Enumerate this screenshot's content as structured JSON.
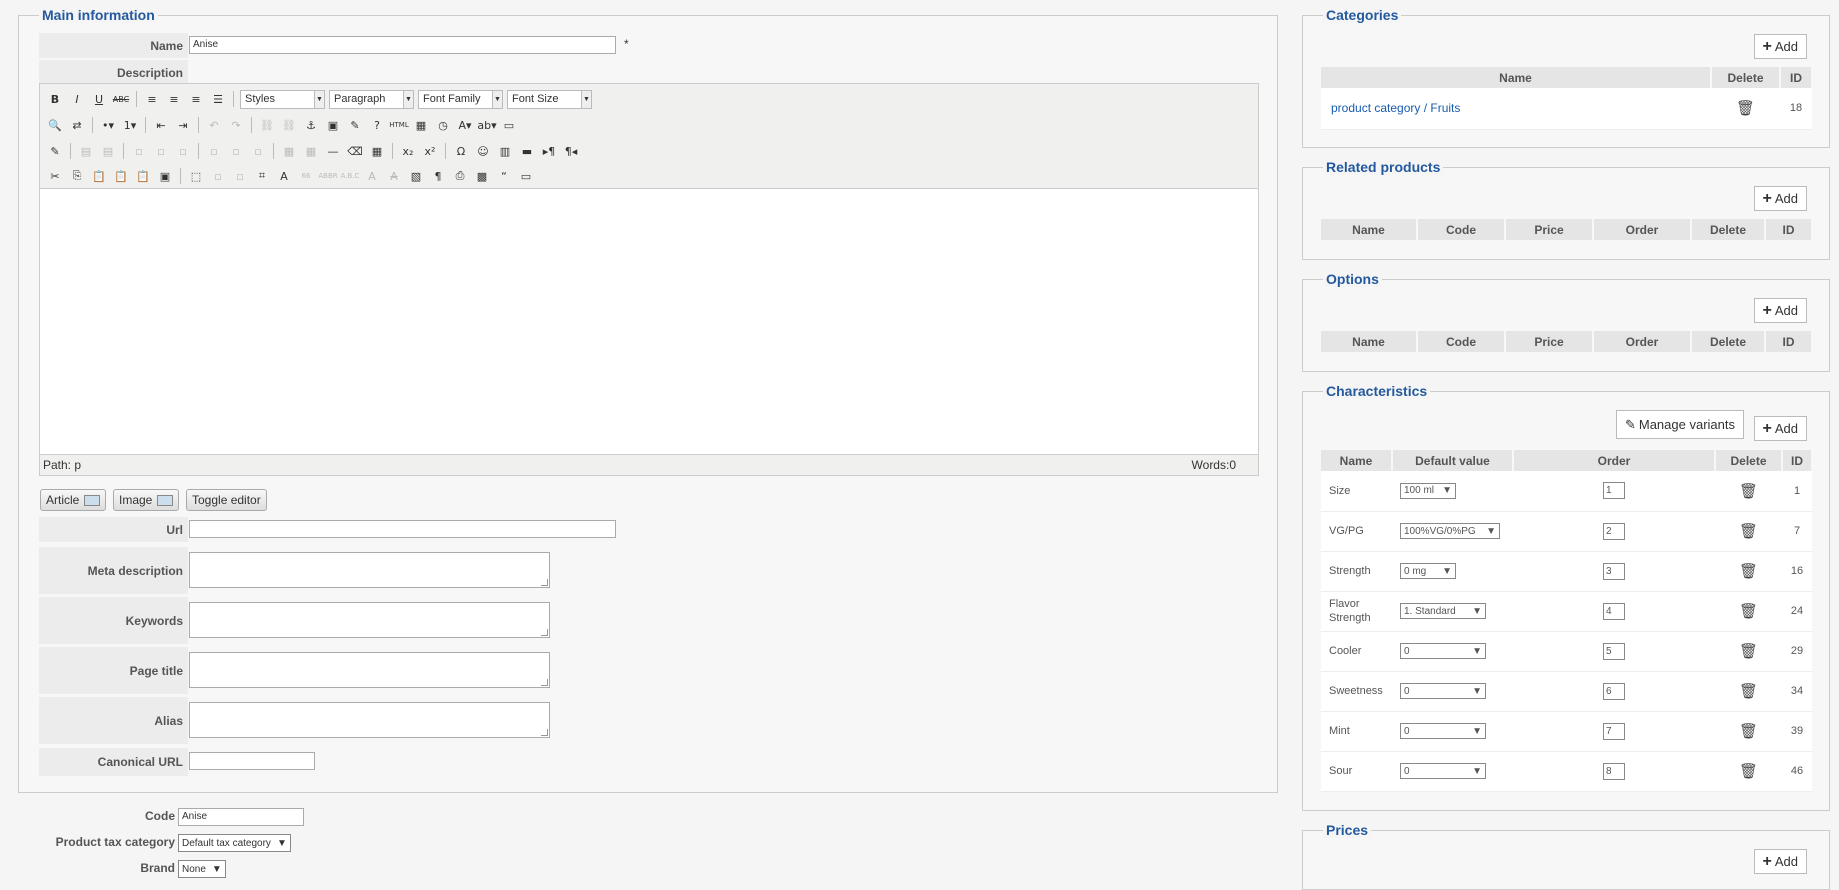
{
  "main_info": {
    "legend": "Main information",
    "name_label": "Name",
    "name_value": "Anise",
    "required_mark": "*",
    "description_label": "Description",
    "editor": {
      "styles": "Styles",
      "paragraph": "Paragraph",
      "font_family": "Font Family",
      "font_size": "Font Size",
      "path": "Path: p",
      "words": "Words:0"
    },
    "buttons": {
      "article": "Article",
      "image": "Image",
      "toggle": "Toggle editor"
    },
    "url_label": "Url",
    "url_value": "",
    "meta_label": "Meta description",
    "keywords_label": "Keywords",
    "page_title_label": "Page title",
    "alias_label": "Alias",
    "canonical_label": "Canonical URL"
  },
  "bottom": {
    "code_label": "Code",
    "code_value": "Anise",
    "tax_label": "Product tax category",
    "tax_value": "Default tax category",
    "brand_label": "Brand",
    "brand_value": "None"
  },
  "categories": {
    "legend": "Categories",
    "add": "Add",
    "headers": [
      "Name",
      "Delete",
      "ID"
    ],
    "rows": [
      {
        "name": "product category / Fruits",
        "id": "18"
      }
    ]
  },
  "related": {
    "legend": "Related products",
    "add": "Add",
    "headers": [
      "Name",
      "Code",
      "Price",
      "Order",
      "Delete",
      "ID"
    ]
  },
  "options": {
    "legend": "Options",
    "add": "Add",
    "headers": [
      "Name",
      "Code",
      "Price",
      "Order",
      "Delete",
      "ID"
    ]
  },
  "characteristics": {
    "legend": "Characteristics",
    "manage": "Manage variants",
    "add": "Add",
    "headers": [
      "Name",
      "Default value",
      "Order",
      "Delete",
      "ID"
    ],
    "rows": [
      {
        "name": "Size",
        "value": "100 ml",
        "order": "1",
        "id": "1"
      },
      {
        "name": "VG/PG",
        "value": "100%VG/0%PG",
        "order": "2",
        "id": "7"
      },
      {
        "name": "Strength",
        "value": "0 mg",
        "order": "3",
        "id": "16"
      },
      {
        "name": "Flavor Strength",
        "value": "1. Standard",
        "order": "4",
        "id": "24"
      },
      {
        "name": "Cooler",
        "value": "0",
        "order": "5",
        "id": "29"
      },
      {
        "name": "Sweetness",
        "value": "0",
        "order": "6",
        "id": "34"
      },
      {
        "name": "Mint",
        "value": "0",
        "order": "7",
        "id": "39"
      },
      {
        "name": "Sour",
        "value": "0",
        "order": "8",
        "id": "46"
      }
    ]
  },
  "prices": {
    "legend": "Prices",
    "add": "Add"
  }
}
